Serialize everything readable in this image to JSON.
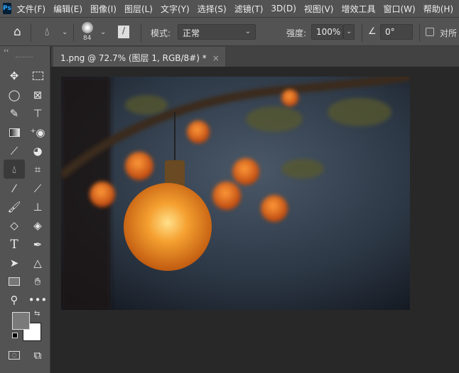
{
  "app": {
    "logo": "Ps"
  },
  "menu": [
    "文件(F)",
    "编辑(E)",
    "图像(I)",
    "图层(L)",
    "文字(Y)",
    "选择(S)",
    "滤镜(T)",
    "3D(D)",
    "视图(V)",
    "增效工具",
    "窗口(W)",
    "帮助(H)"
  ],
  "options": {
    "brush_size": "84",
    "mode_label": "模式:",
    "mode_value": "正常",
    "strength_label": "强度:",
    "strength_value": "100%",
    "angle_value": "0°",
    "sample_all_label": "对所"
  },
  "document": {
    "tab_title": "1.png @ 72.7% (图层 1, RGB/8#) *",
    "close": "×"
  },
  "toolbar": {
    "collapse": "‹‹"
  },
  "colors": {
    "foreground": "#7a7a7a",
    "background": "#ffffff",
    "accent": "#31a8ff"
  }
}
